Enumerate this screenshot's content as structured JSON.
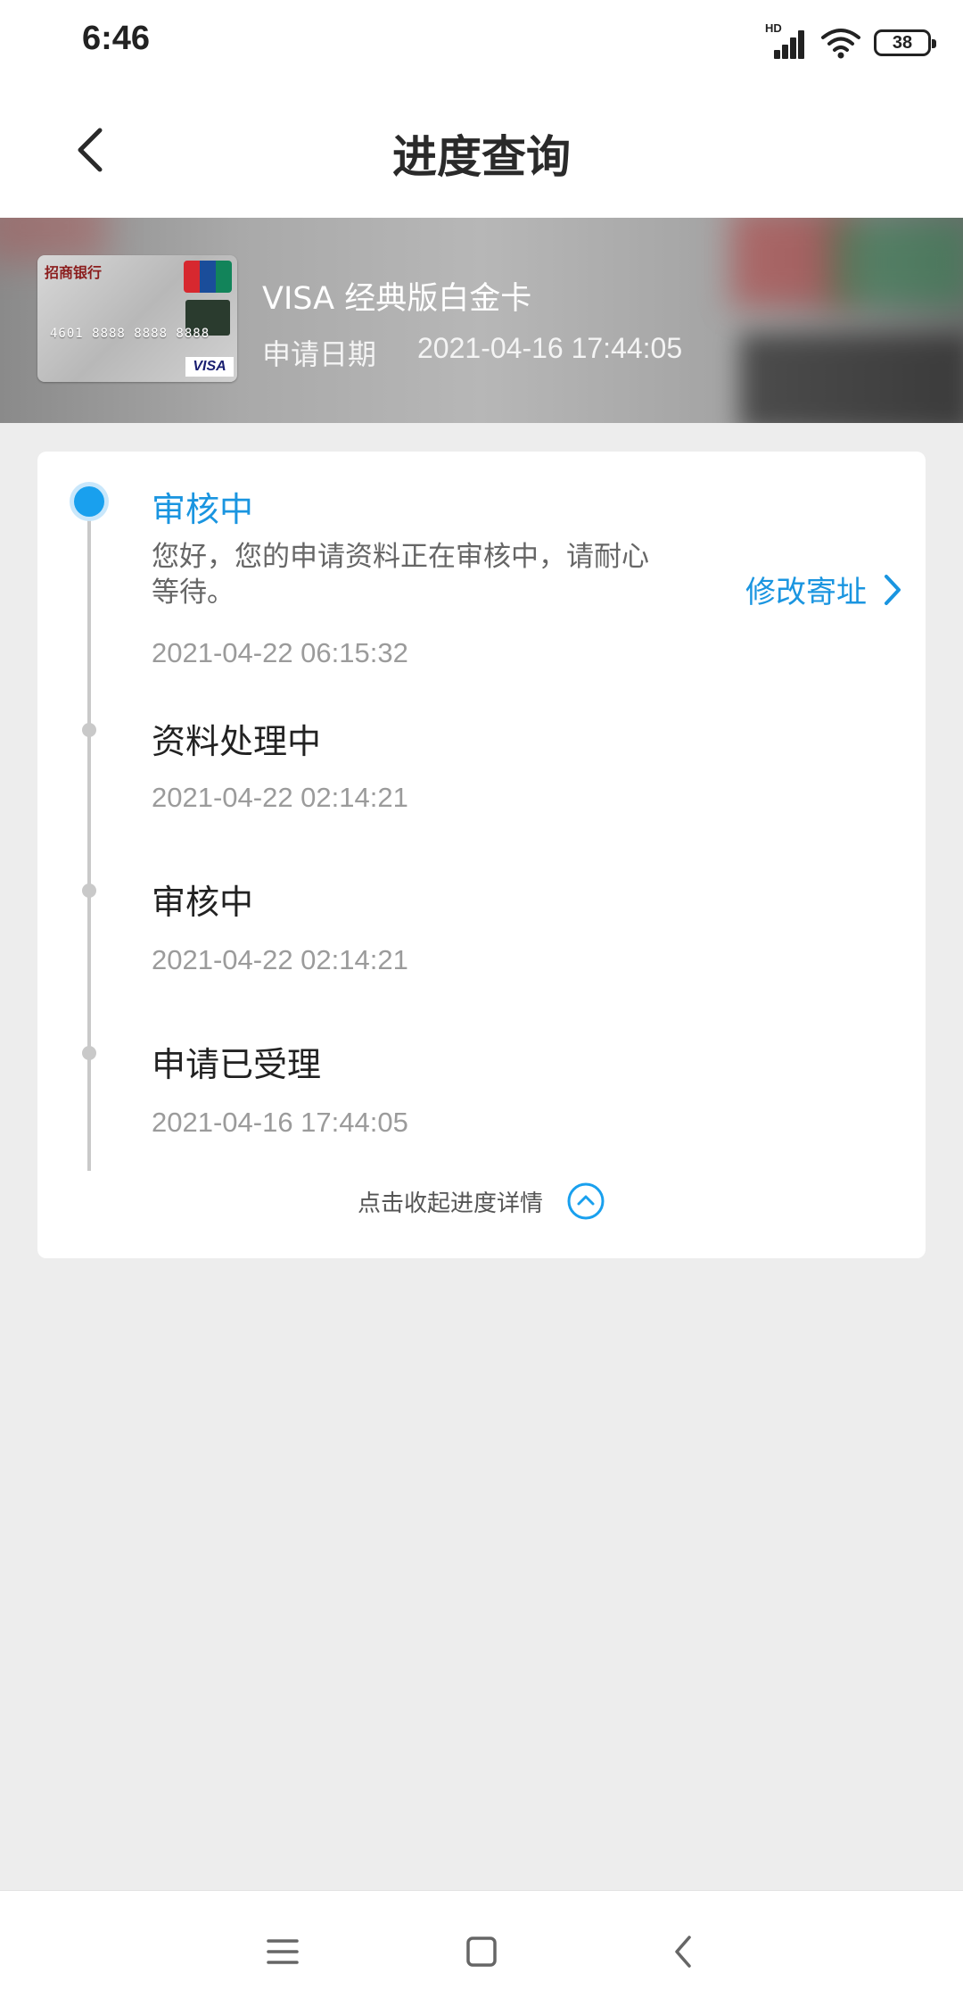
{
  "status_bar": {
    "time": "6:46",
    "network_label": "HD",
    "battery": "38"
  },
  "header": {
    "title": "进度查询"
  },
  "card": {
    "name": "VISA 经典版白金卡",
    "apply_label": "申请日期",
    "apply_date": "2021-04-16 17:44:05",
    "thumb": {
      "bank": "招商银行",
      "number": "4601 8888 8888 8888",
      "network": "VISA"
    }
  },
  "timeline": [
    {
      "title": "审核中",
      "desc": "您好，您的申请资料正在审核中，请耐心等待。",
      "time": "2021-04-22 06:15:32",
      "active": true
    },
    {
      "title": "资料处理中",
      "time": "2021-04-22 02:14:21",
      "active": false
    },
    {
      "title": "审核中",
      "time": "2021-04-22 02:14:21",
      "active": false
    },
    {
      "title": "申请已受理",
      "time": "2021-04-16 17:44:05",
      "active": false
    }
  ],
  "actions": {
    "modify_address": "修改寄址",
    "collapse": "点击收起进度详情"
  },
  "colors": {
    "accent": "#19a0ee",
    "link": "#1a95e0",
    "background": "#ededed"
  },
  "icons": [
    "back-arrow-icon",
    "chevron-right-icon",
    "chevron-up-circle-icon",
    "menu-icon",
    "home-square-icon",
    "back-triangle-icon",
    "wifi-icon",
    "signal-icon",
    "battery-icon"
  ]
}
